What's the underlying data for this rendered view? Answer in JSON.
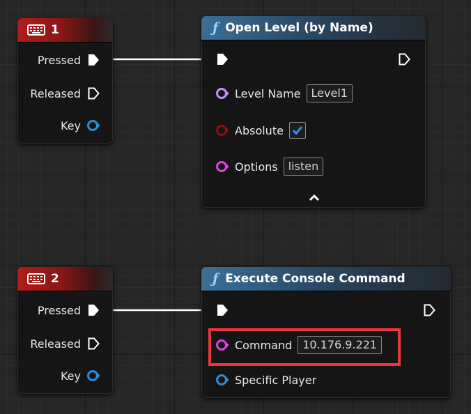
{
  "nodes": {
    "key1": {
      "title": "1",
      "pins": {
        "pressed": "Pressed",
        "released": "Released",
        "key": "Key"
      }
    },
    "open_level": {
      "title": "Open Level (by Name)",
      "icon": "function-icon",
      "pins": {
        "level_name": "Level Name",
        "level_name_value": "Level1",
        "absolute": "Absolute",
        "absolute_checked": true,
        "options": "Options",
        "options_value": "listen"
      }
    },
    "key2": {
      "title": "2",
      "pins": {
        "pressed": "Pressed",
        "released": "Released",
        "key": "Key"
      }
    },
    "exec_console": {
      "title": "Execute Console Command",
      "icon": "function-icon",
      "pins": {
        "command": "Command",
        "command_value": "10.176.9.221",
        "specific_player": "Specific Player"
      }
    }
  },
  "colors": {
    "exec_pin": "#ffffff",
    "string_pin": "#e040e0",
    "name_pin": "#c090ff",
    "bool_pin": "#8a1010",
    "struct_pin": "#2b8fd6",
    "highlight": "#e8363c",
    "checkmark": "#2f8fff"
  }
}
